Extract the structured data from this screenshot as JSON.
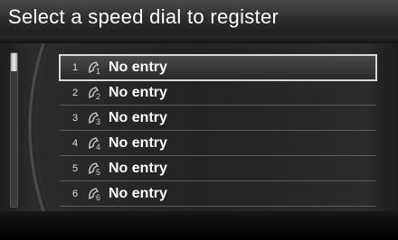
{
  "header": {
    "title": "Select a speed dial to register"
  },
  "speed_dial": {
    "entries": [
      {
        "number": "1",
        "label": "No entry",
        "icon": "speed-dial-1-icon",
        "selected": true
      },
      {
        "number": "2",
        "label": "No entry",
        "icon": "speed-dial-2-icon",
        "selected": false
      },
      {
        "number": "3",
        "label": "No entry",
        "icon": "speed-dial-3-icon",
        "selected": false
      },
      {
        "number": "4",
        "label": "No entry",
        "icon": "speed-dial-4-icon",
        "selected": false
      },
      {
        "number": "5",
        "label": "No entry",
        "icon": "speed-dial-5-icon",
        "selected": false
      },
      {
        "number": "6",
        "label": "No entry",
        "icon": "speed-dial-6-icon",
        "selected": false
      }
    ]
  },
  "colors": {
    "background": "#000000",
    "text": "#ffffff",
    "highlight": "#d8d8d8"
  }
}
